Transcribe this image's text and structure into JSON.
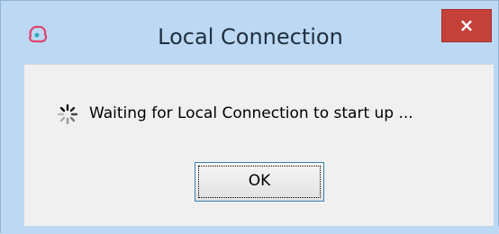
{
  "window": {
    "title": "Local Connection",
    "close_glyph": "×",
    "app_icon": "app-logo-icon",
    "frame_color": "#bcd8f2",
    "close_color": "#c4413a"
  },
  "dialog": {
    "message": "Waiting for Local Connection to start up ...",
    "spinner_icon": "loading-spinner-icon",
    "ok_label": "OK"
  }
}
